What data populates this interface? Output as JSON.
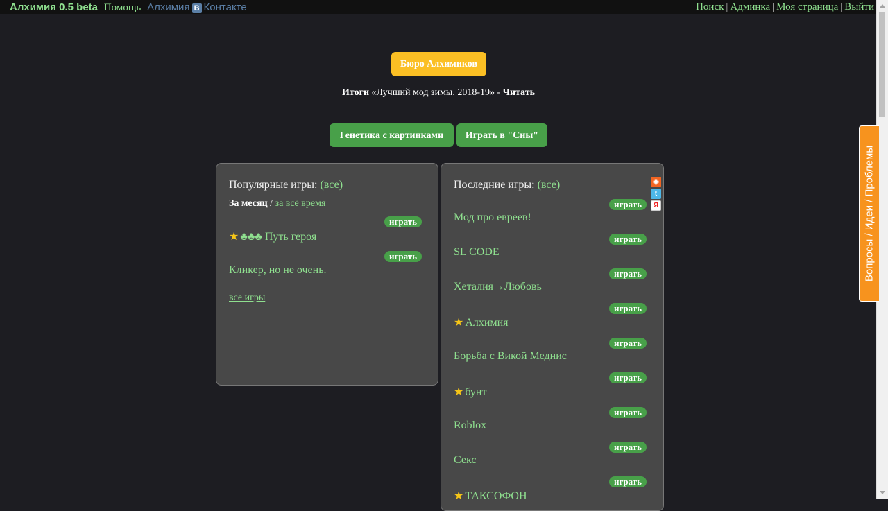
{
  "topbar": {
    "brand": "Алхимия 0.5 beta",
    "help": "Помощь",
    "vk_prefix": "Алхимия",
    "vk_badge": "В",
    "vk_suffix": "Контакте",
    "search": "Поиск",
    "admin": "Админка",
    "mypage": "Моя страница",
    "logout": "Выйти"
  },
  "feedback_tab": "Вопросы / Идеи / Проблемы",
  "bureau_button": "Бюро Алхимиков",
  "results": {
    "label": "Итоги",
    "text": "«Лучший мод зимы. 2018-19» -",
    "read_link": "Читать"
  },
  "buttons": {
    "genetics": "Генетика с картинками",
    "dreams": "Играть в \"Сны\""
  },
  "popular": {
    "title": "Популярные игры:",
    "all_link": "(все)",
    "period_month": "За месяц",
    "period_sep": "/",
    "period_all": "за всё время",
    "play_label": "играть",
    "games": [
      {
        "name": "Путь героя",
        "star": "★",
        "prefix": "♣♣♣"
      },
      {
        "name": "Кликер, но не очень."
      }
    ],
    "all_games_link": "все игры"
  },
  "latest": {
    "title": "Последние игры:",
    "all_link": "(все)",
    "play_label": "играть",
    "games": [
      {
        "name": "Мод про евреев!"
      },
      {
        "name": "SL CODE"
      },
      {
        "name": "Хеталия→Любовь"
      },
      {
        "name": "Алхимия",
        "star": "★"
      },
      {
        "name": "Борьба с Викой Меднис"
      },
      {
        "name": "бунт",
        "star": "★"
      },
      {
        "name": "Roblox"
      },
      {
        "name": "Секс"
      },
      {
        "name": "ТАКСОФОН",
        "star": "★"
      }
    ]
  },
  "side_icons": [
    "rss-icon",
    "twitter-icon",
    "yandex-icon"
  ]
}
